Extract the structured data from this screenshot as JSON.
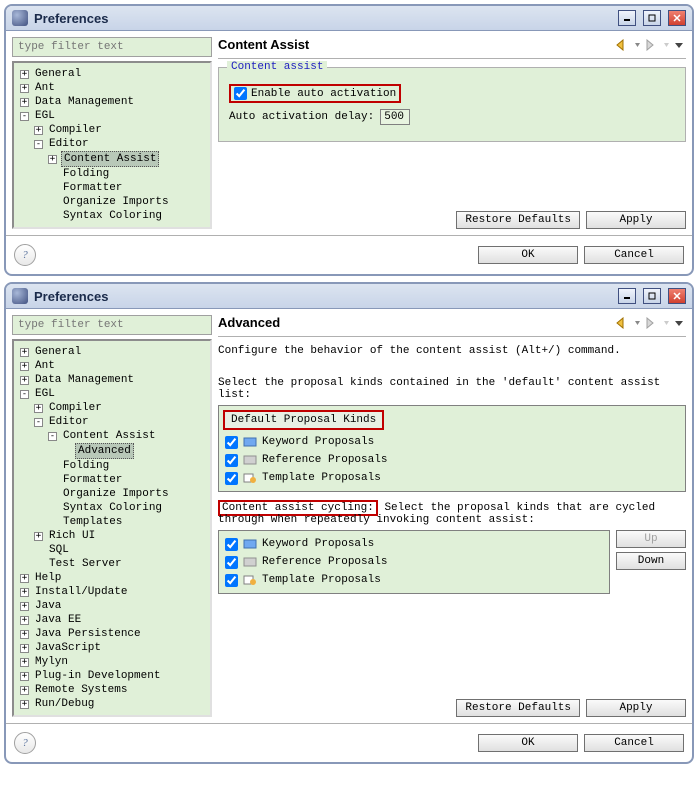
{
  "win1": {
    "title": "Preferences",
    "filter_placeholder": "type filter text",
    "page_title": "Content Assist",
    "group_legend": "Content assist",
    "enable_label": "Enable auto activation",
    "delay_label": "Auto activation delay:",
    "delay_value": "500",
    "restore_defaults": "Restore Defaults",
    "apply": "Apply",
    "ok": "OK",
    "cancel": "Cancel",
    "tree": {
      "general": "General",
      "ant": "Ant",
      "data_mgmt": "Data Management",
      "egl": "EGL",
      "compiler": "Compiler",
      "editor": "Editor",
      "content_assist": "Content Assist",
      "folding": "Folding",
      "formatter": "Formatter",
      "organize_imports": "Organize Imports",
      "syntax_coloring": "Syntax Coloring"
    }
  },
  "win2": {
    "title": "Preferences",
    "filter_placeholder": "type filter text",
    "page_title": "Advanced",
    "description": "Configure the behavior of the content assist (Alt+/) command.",
    "default_list_label": "Select the proposal kinds contained in the 'default' content assist list:",
    "default_header": "Default Proposal Kinds",
    "keyword": "Keyword Proposals",
    "reference": "Reference Proposals",
    "template": "Template Proposals",
    "cycling_label": "Content assist cycling:",
    "cycling_desc": "Select the proposal kinds that are cycled through when repeatedly invoking content assist:",
    "up": "Up",
    "down": "Down",
    "restore_defaults": "Restore Defaults",
    "apply": "Apply",
    "ok": "OK",
    "cancel": "Cancel",
    "tree": {
      "general": "General",
      "ant": "Ant",
      "data_mgmt": "Data Management",
      "egl": "EGL",
      "compiler": "Compiler",
      "editor": "Editor",
      "content_assist": "Content Assist",
      "advanced": "Advanced",
      "folding": "Folding",
      "formatter": "Formatter",
      "organize_imports": "Organize Imports",
      "syntax_coloring": "Syntax Coloring",
      "templates": "Templates",
      "rich_ui": "Rich UI",
      "sql": "SQL",
      "test_server": "Test Server",
      "help": "Help",
      "install_update": "Install/Update",
      "java": "Java",
      "java_ee": "Java EE",
      "java_persistence": "Java Persistence",
      "javascript": "JavaScript",
      "mylyn": "Mylyn",
      "plugin_dev": "Plug-in Development",
      "remote_systems": "Remote Systems",
      "run_debug": "Run/Debug"
    }
  }
}
